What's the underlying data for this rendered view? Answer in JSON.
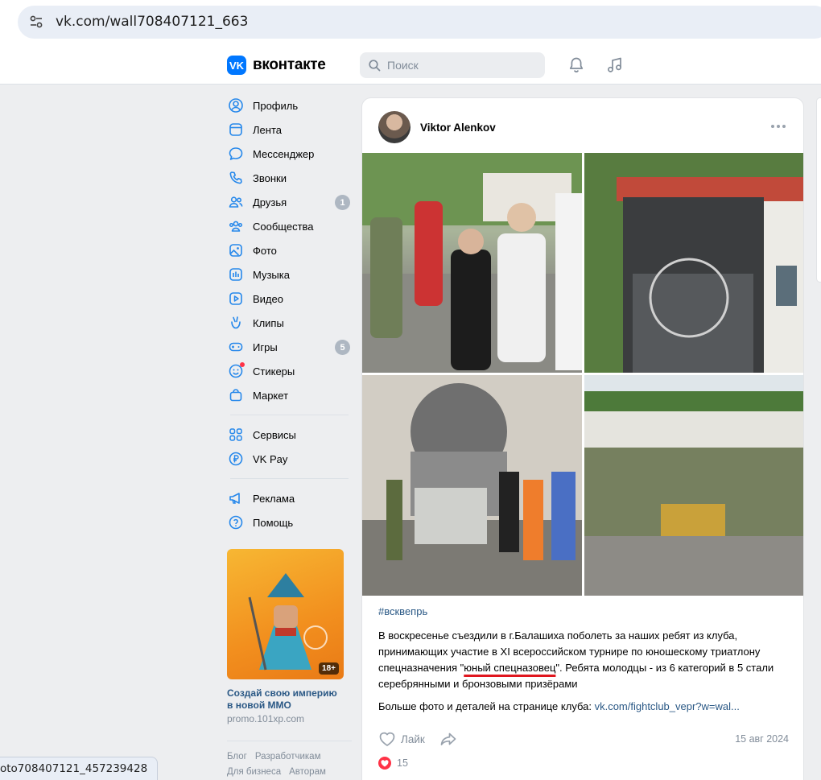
{
  "browser": {
    "url": "vk.com/wall708407121_663",
    "status_url": "oto708407121_457239428"
  },
  "header": {
    "logo_text": "вконтакте",
    "logo_mark": "VK",
    "search_placeholder": "Поиск",
    "icons": [
      "bell-icon",
      "music-icon"
    ]
  },
  "sidebar": {
    "items": [
      {
        "label": "Профиль",
        "icon": "profile-icon"
      },
      {
        "label": "Лента",
        "icon": "feed-icon"
      },
      {
        "label": "Мессенджер",
        "icon": "messenger-icon"
      },
      {
        "label": "Звонки",
        "icon": "phone-icon"
      },
      {
        "label": "Друзья",
        "icon": "friends-icon",
        "badge": "1"
      },
      {
        "label": "Сообщества",
        "icon": "communities-icon"
      },
      {
        "label": "Фото",
        "icon": "photo-icon"
      },
      {
        "label": "Музыка",
        "icon": "music-icon"
      },
      {
        "label": "Видео",
        "icon": "video-icon"
      },
      {
        "label": "Клипы",
        "icon": "clips-icon"
      },
      {
        "label": "Игры",
        "icon": "games-icon",
        "badge": "5"
      },
      {
        "label": "Стикеры",
        "icon": "stickers-icon"
      },
      {
        "label": "Маркет",
        "icon": "market-icon"
      },
      {
        "label": "Сервисы",
        "icon": "services-icon"
      },
      {
        "label": "VK Pay",
        "icon": "vkpay-icon"
      },
      {
        "label": "Реклама",
        "icon": "ads-icon"
      },
      {
        "label": "Помощь",
        "icon": "help-icon"
      }
    ],
    "ad": {
      "badge": "18+",
      "title": "Создай свою империю в новой MMO",
      "domain": "promo.101xp.com"
    },
    "footer": [
      "Блог",
      "Разработчикам",
      "Для бизнеса",
      "Авторам"
    ]
  },
  "post": {
    "author": "Viktor Alenkov",
    "hashtag": "#всквепрь",
    "text_before": "В воскресенье съездили в г.Балашиха поболеть за наших ребят из клуба, принимающих участие в XI всероссийском турнире по юношескому триатлону спецназначения \"",
    "text_underlined": "юный спецназовец",
    "text_after": "\". Ребята молодцы - из 6 категорий в 5 стали серебрянными и бронзовыми призёрами",
    "more_prefix": "Больше фото и деталей на странице клуба: ",
    "more_link": "vk.com/fightclub_vepr?w=wal...",
    "like_label": "Лайк",
    "date": "15 авг 2024",
    "likes_count": "15"
  },
  "colors": {
    "accent": "#0077ff",
    "link": "#2a5885",
    "like": "#ff3347",
    "underline": "#e0161e"
  }
}
